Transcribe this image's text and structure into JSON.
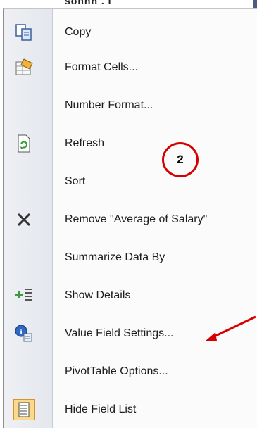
{
  "header": {
    "cut_text": "sonnn . I"
  },
  "menu": {
    "items": [
      {
        "label": "Copy",
        "icon": "copy-icon"
      },
      {
        "label": "Format Cells...",
        "icon": "format-cells-icon"
      },
      {
        "label": "Number Format...",
        "icon": ""
      },
      {
        "label": "Refresh",
        "icon": "refresh-icon"
      },
      {
        "label": "Sort",
        "icon": ""
      },
      {
        "label": "Remove \"Average of Salary\"",
        "icon": "remove-x-icon"
      },
      {
        "label": "Summarize Data By",
        "icon": ""
      },
      {
        "label": "Show Details",
        "icon": "show-details-icon"
      },
      {
        "label": "Value Field Settings...",
        "icon": "value-field-settings-icon"
      },
      {
        "label": "PivotTable Options...",
        "icon": ""
      },
      {
        "label": "Hide Field List",
        "icon": "field-list-icon"
      }
    ]
  },
  "annotation": {
    "callout_number": "2"
  },
  "colors": {
    "callout_red": "#d60000",
    "gutter": "#e9ecf1",
    "accent_orange": "#f4b44a"
  }
}
